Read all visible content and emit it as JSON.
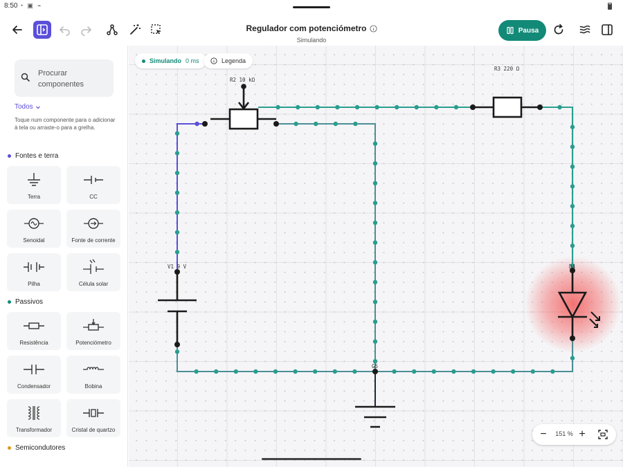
{
  "status": {
    "time": "8:50"
  },
  "toolbar": {
    "title": "Regulador com potenciómetro",
    "subtitle": "Simulando",
    "pause_label": "Pausa"
  },
  "sidebar": {
    "search_placeholder": "Procurar componentes",
    "filter_label": "Todos",
    "hint": "Toque num componente para o adicionar à tela ou arraste-o para a grelha.",
    "sections": [
      {
        "name": "Fontes e terra",
        "color": "#5b4fd9",
        "items": [
          "Terra",
          "CC",
          "Senoidal",
          "Fonte de corrente",
          "Pilha",
          "Célula solar"
        ]
      },
      {
        "name": "Passivos",
        "color": "#138a78",
        "items": [
          "Resistência",
          "Potenciómetro",
          "Condensador",
          "Bobina",
          "Transformador",
          "Cristal de quartzo"
        ]
      },
      {
        "name": "Semicondutores",
        "color": "#d99a1e",
        "items": []
      }
    ]
  },
  "canvas": {
    "sim_label": "Simulando",
    "sim_time": "0 ms",
    "legend_label": "Legenda",
    "labels": {
      "r2": "R2  10 kΩ",
      "r3": "R3  220 Ω",
      "v1": "V1  9 V",
      "d4": "D4",
      "gnd": "G5"
    },
    "zoom": "151 %"
  },
  "colors": {
    "accent": "#5b4fd9",
    "sim_green": "#138a78",
    "wire_active": "#2a9d8f",
    "wire_blue": "#5b4fd9",
    "led_glow": "#f25c5c"
  }
}
